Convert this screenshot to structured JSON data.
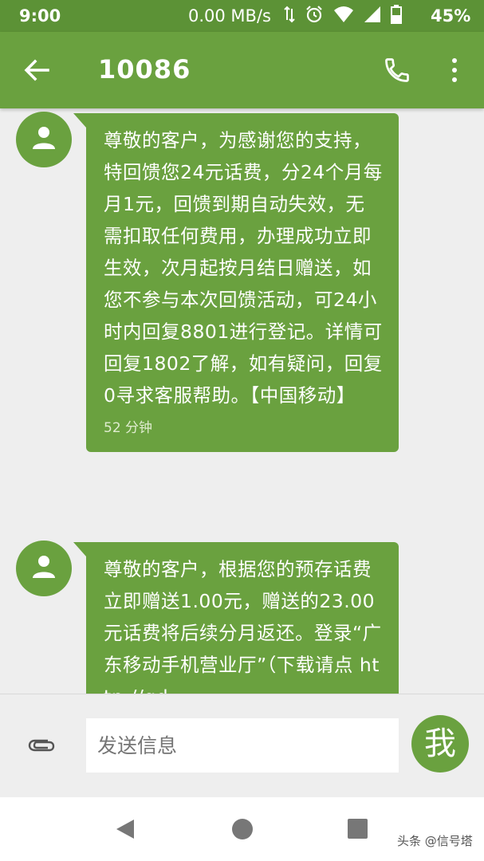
{
  "status_bar": {
    "time": "9:00",
    "network_speed": "0.00 MB/s",
    "battery_percent": "45%"
  },
  "app_bar": {
    "title": "10086"
  },
  "messages": [
    {
      "text": "尊敬的客户，为感谢您的支持，特回馈您24元话费，分24个月每月1元，回馈到期自动失效，无需扣取任何费用，办理成功立即生效，次月起按月结日赠送，如您不参与本次回馈活动，可24小时内回复8801进行登记。详情可回复1802了解，如有疑问，回复0寻求客服帮助。【中国移动】",
      "timestamp": "52 分钟"
    },
    {
      "text": "尊敬的客户，根据您的预存话费立即赠送1.00元，赠送的23.00元话费将后续分月返还。登录“广东移动手机营业厅”（下载请点 http://gd",
      "timestamp": ""
    }
  ],
  "compose": {
    "placeholder": "发送信息",
    "avatar_label": "我"
  },
  "watermark": "头条 @信号塔",
  "colors": {
    "status_bar": "#5c9236",
    "accent": "#6aa13f",
    "background": "#eeeeee"
  }
}
